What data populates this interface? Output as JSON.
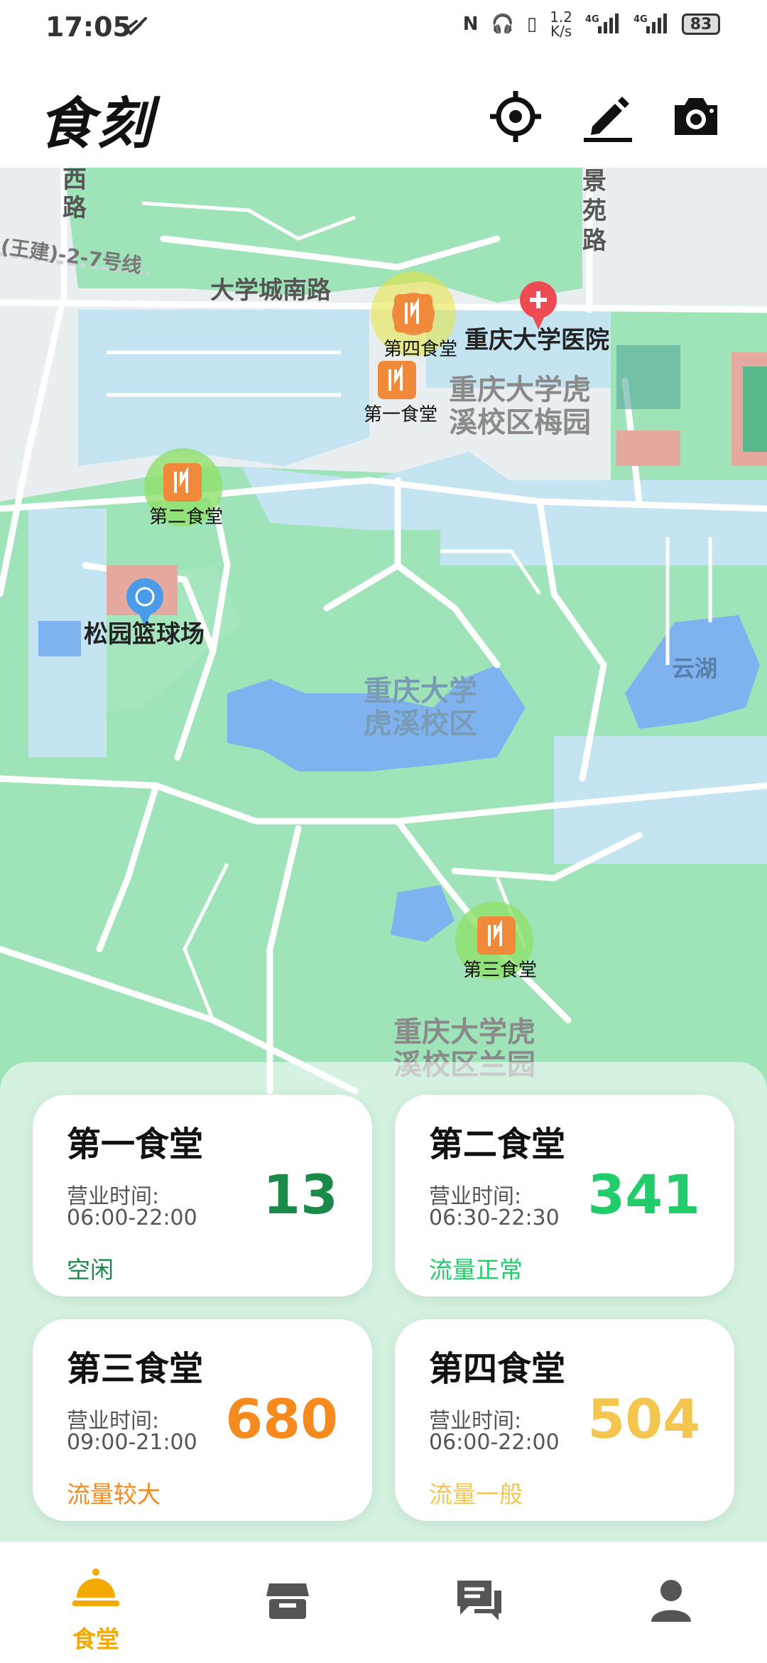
{
  "status_bar": {
    "time": "17:05",
    "speed_top": "1.2",
    "speed_bottom": "K/s",
    "battery": "83"
  },
  "header": {
    "title": "食刻"
  },
  "map": {
    "roads": [
      "西路",
      "景苑路",
      "大学城南路",
      "(王建)-2-7号线"
    ],
    "places": [
      "重庆大学医院",
      "重庆大学虎溪校区梅园",
      "松园篮球场",
      "重庆大学虎溪校区",
      "云湖",
      "重庆大学虎溪校区兰园"
    ],
    "canteen_markers": [
      "第四食堂",
      "第一食堂",
      "第二食堂",
      "第三食堂"
    ]
  },
  "canteens": [
    {
      "name": "第一食堂",
      "hours_label": "营业时间:",
      "hours": "06:00-22:00",
      "count": "13",
      "status": "空闲",
      "color": "#1a8a4a"
    },
    {
      "name": "第二食堂",
      "hours_label": "营业时间:",
      "hours": "06:30-22:30",
      "count": "341",
      "status": "流量正常",
      "color": "#22cc6a"
    },
    {
      "name": "第三食堂",
      "hours_label": "营业时间:",
      "hours": "09:00-21:00",
      "count": "680",
      "status": "流量较大",
      "color": "#f58a1f"
    },
    {
      "name": "第四食堂",
      "hours_label": "营业时间:",
      "hours": "06:00-22:00",
      "count": "504",
      "status": "流量一般",
      "color": "#f5c64f"
    }
  ],
  "tabbar": {
    "active_label": "食堂",
    "accent": "#f2a900"
  }
}
